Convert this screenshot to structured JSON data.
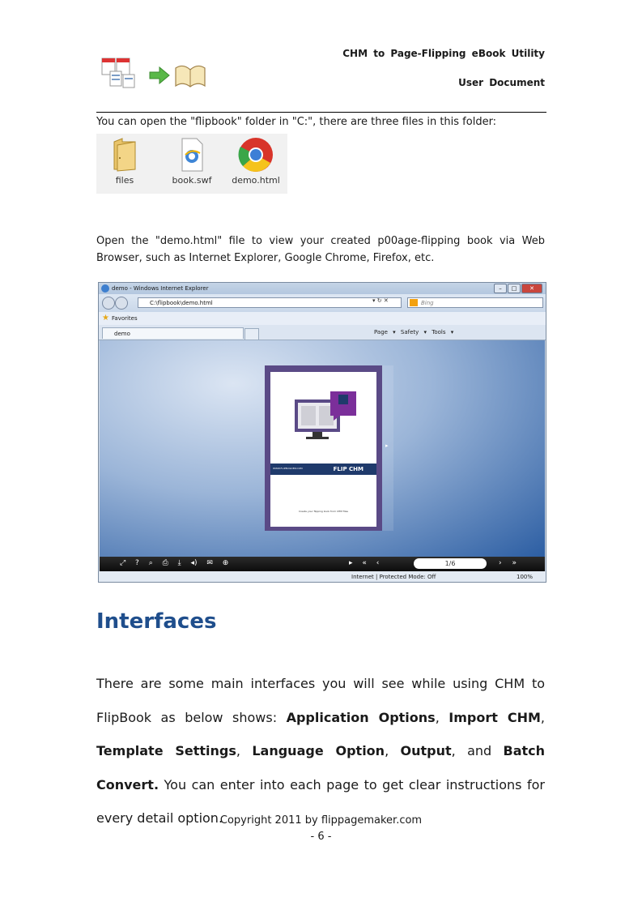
{
  "header": {
    "title": "CHM to Page-Flipping eBook Utility",
    "subtitle": "User Document"
  },
  "intro": "You can open the \"flipbook\" folder in \"C:\", there are three files in this folder:",
  "files": [
    {
      "label": "files",
      "icon": "folder-icon"
    },
    {
      "label": "book.swf",
      "icon": "swf-file-icon"
    },
    {
      "label": "demo.html",
      "icon": "chrome-icon"
    }
  ],
  "open_text": "Open the \"demo.html\" file to view your created p00age-flipping book via Web Browser, such as Internet Explorer, Google Chrome, Firefox, etc.",
  "browser": {
    "window_title": "demo - Windows Internet Explorer",
    "address": "C:\\flipbook\\demo.html",
    "search_placeholder": "Bing",
    "favorites_label": "Favorites",
    "tab_label": "demo",
    "command_bar": "Page ▾ Safety ▾ Tools ▾",
    "book_cover_url": "WWW.FLIPBUILDER.COM",
    "book_cover_brand": "FLIP CHM",
    "book_cover_tagline": "Create your flipping book from CHM files",
    "page_indicator": "1/6",
    "status_mode": "Internet | Protected Mode: Off",
    "zoom": "100%"
  },
  "section_heading": "Interfaces",
  "body": {
    "lead": "There are some main interfaces you will see while using CHM to FlipBook as below shows: ",
    "item1": "Application Options",
    "sep1": ", ",
    "item2": "Import CHM",
    "sep2": ", ",
    "item3": "Template Settings",
    "sep3": ", ",
    "item4": "Language Option",
    "sep4": ", ",
    "item5": "Output",
    "sep5": ", and ",
    "item6": "Batch Convert.",
    "tail": " You can enter into each page to get clear instructions for every detail option."
  },
  "footer": {
    "copyright": "Copyright 2011 by flippagemaker.com",
    "page": "- 6 -"
  }
}
